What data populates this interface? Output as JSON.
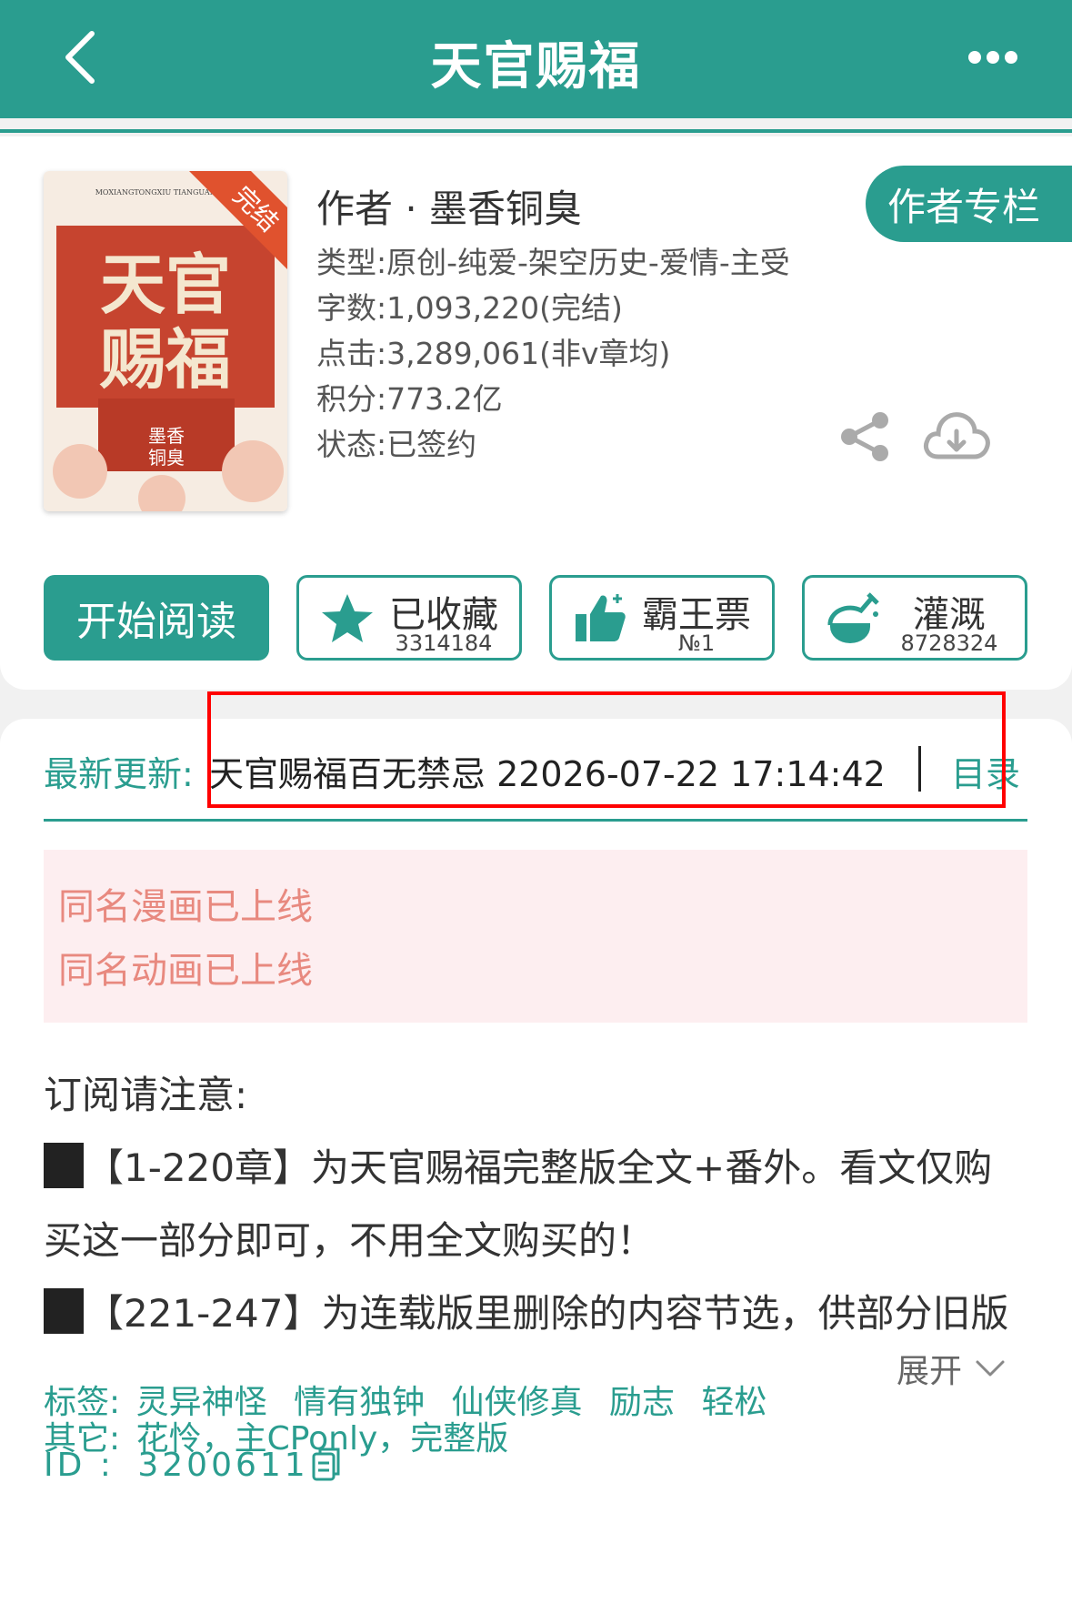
{
  "header": {
    "title": "天官赐福",
    "back_icon": "chevron-left-icon",
    "more_icon": "more-horizontal-icon"
  },
  "book": {
    "cover_badge": "完结",
    "cover_title": "天官赐福",
    "cover_pinyin": "MOXIANGTONGXIU TIANGUANCIFU",
    "cover_author": "墨香铜臭",
    "author": "作者 · 墨香铜臭",
    "author_column_button": "作者专栏",
    "type": "类型:原创-纯爱-架空历史-爱情-主受",
    "word_count": "字数:1,093,220(完结)",
    "clicks": "点击:3,289,061(非v章均)",
    "score": "积分:773.2亿",
    "status": "状态:已签约"
  },
  "actions": {
    "read_button": "开始阅读",
    "collect": {
      "label": "已收藏",
      "count": "3314184"
    },
    "vote": {
      "label": "霸王票",
      "count": "№1"
    },
    "nutrient": {
      "label": "灌溉",
      "count": "8728324"
    }
  },
  "update": {
    "label": "最新更新:",
    "text": "天官赐福百无禁忌 22026-07-22 17:14:42",
    "toc_link": "目录"
  },
  "notices": [
    "同名漫画已上线",
    "同名动画已上线"
  ],
  "description": {
    "title": "订阅请注意:",
    "line1": "【1-220章】为天官赐福完整版全文+番外。看文仅购",
    "line2": "买这一部分即可，不用全文购买的！",
    "line3": "【221-247】为连载版里删除的内容节选，供部分旧版",
    "expand": "展开"
  },
  "tags": {
    "label": "标签:",
    "items": [
      "灵异神怪",
      "情有独钟",
      "仙侠修真",
      "励志",
      "轻松"
    ],
    "other_label": "其它:",
    "other_value": "花怜，主CPonly，完整版",
    "id_label": "ID  :",
    "id_value": "3200611"
  },
  "colors": {
    "primary": "#2a9d8f",
    "notice_bg": "#fdeef0",
    "notice_text": "#e8897f",
    "highlight": "#ff0000"
  }
}
